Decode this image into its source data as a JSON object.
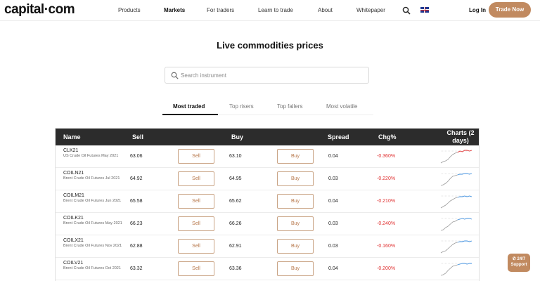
{
  "header": {
    "logo": "capital·com",
    "nav": [
      "Products",
      "Markets",
      "For traders",
      "Learn to trade",
      "About",
      "Whitepaper"
    ],
    "login": "Log In",
    "cta": "Trade Now"
  },
  "title": "Live commodities prices",
  "search": {
    "placeholder": "Search instrument"
  },
  "tabs": [
    "Most traded",
    "Top risers",
    "Top fallers",
    "Most volatile"
  ],
  "table": {
    "headers": {
      "name": "Name",
      "sell": "Sell",
      "buy": "Buy",
      "spread": "Spread",
      "chg": "Chg%",
      "charts": "Charts (2 days)"
    },
    "sell_label": "Sell",
    "buy_label": "Buy",
    "rows": [
      {
        "symbol": "CLK21",
        "name": "US Crude Oil Futures May 2021",
        "sell": "63.06",
        "buy": "63.10",
        "spread": "0.04",
        "chg": "-0.360%"
      },
      {
        "symbol": "COILN21",
        "name": "Brent Crude Oil Futures Jul 2021",
        "sell": "64.92",
        "buy": "64.95",
        "spread": "0.03",
        "chg": "-0.220%"
      },
      {
        "symbol": "COILM21",
        "name": "Brent Crude Oil Futures Jun 2021",
        "sell": "65.58",
        "buy": "65.62",
        "spread": "0.04",
        "chg": "-0.210%"
      },
      {
        "symbol": "COILK21",
        "name": "Brent Crude Oil Futures May 2021",
        "sell": "66.23",
        "buy": "66.26",
        "spread": "0.03",
        "chg": "-0.240%"
      },
      {
        "symbol": "COILX21",
        "name": "Brent Crude Oil Futures Nov 2021",
        "sell": "62.88",
        "buy": "62.91",
        "spread": "0.03",
        "chg": "-0.160%"
      },
      {
        "symbol": "COILV21",
        "name": "Brent Crude Oil Futures Oct 2021",
        "sell": "63.32",
        "buy": "63.36",
        "spread": "0.04",
        "chg": "-0.200%"
      }
    ]
  },
  "support": {
    "line1": "24/7",
    "line2": "Support"
  },
  "colors": {
    "accent": "#c18a60",
    "negative": "#e03131",
    "header_bg": "#2c2c2c",
    "spark_up": "#3d8fe0",
    "spark_down": "#e03131"
  },
  "icons": {
    "search": "search-icon",
    "flag": "uk-flag-icon",
    "chat": "chat-icon"
  }
}
